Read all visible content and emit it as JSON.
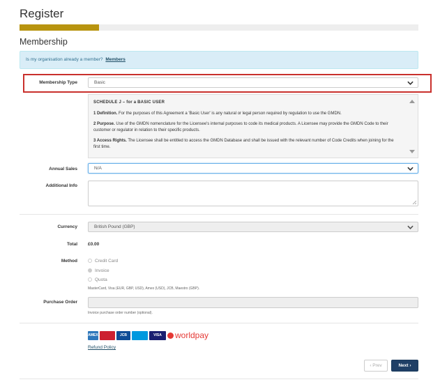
{
  "page": {
    "title": "Register"
  },
  "progress": {
    "percent": 20
  },
  "membership": {
    "heading": "Membership",
    "info_text": "Is my organisation already a member?",
    "info_link": "Members"
  },
  "form": {
    "membership_type": {
      "label": "Membership Type",
      "value": "Basic"
    },
    "terms": {
      "heading": "SCHEDULE J – for a BASIC USER",
      "items": [
        {
          "lead": "1 Definition.",
          "text": " For the purposes of this Agreement a 'Basic User' is any natural or legal person required by regulation to use the GMDN."
        },
        {
          "lead": "2 Purpose.",
          "text": " Use of the GMDN nomenclature for the Licensee's internal purposes to code its medical products. A Licensee may provide the GMDN Code to their customer or regulator in relation to their specific products."
        },
        {
          "lead": "3 Access Rights.",
          "text": " The Licensee shall be entitled to access the GMDN Database and shall be issued with the relevant number of Code Credits when joining for the first time."
        }
      ]
    },
    "annual_sales": {
      "label": "Annual Sales",
      "value": "N/A"
    },
    "additional_info": {
      "label": "Additional Info",
      "value": ""
    },
    "currency": {
      "label": "Currency",
      "value": "British Pound (GBP)"
    },
    "total": {
      "label": "Total",
      "value": "£0.00"
    },
    "method": {
      "label": "Method",
      "options": [
        {
          "label": "Credit Card",
          "checked": false
        },
        {
          "label": "Invoice",
          "checked": true
        },
        {
          "label": "Quota",
          "checked": false
        }
      ],
      "hint": "MasterCard, Visa (EUR, GBP, USD), Amex (USD), JCB, Maestro (GBP)."
    },
    "purchase_order": {
      "label": "Purchase Order",
      "value": "",
      "hint": "Invoice purchase order number (optional)."
    }
  },
  "payment": {
    "cards": [
      {
        "name": "AMEX",
        "color": "#2e77bb"
      },
      {
        "name": "MasterCard",
        "color": "#cc2131"
      },
      {
        "name": "JCB",
        "color": "#0e4c96"
      },
      {
        "name": "Maestro",
        "color": "#0099df"
      },
      {
        "name": "VISA",
        "color": "#1a1f71"
      }
    ],
    "worldpay": "worldpay",
    "refund_link": "Refund Policy"
  },
  "nav": {
    "prev_label": "Prev",
    "next_label": "Next"
  },
  "colors": {
    "accent": "#b8940f",
    "primary": "#1f3f66",
    "highlight": "#c9302c"
  }
}
